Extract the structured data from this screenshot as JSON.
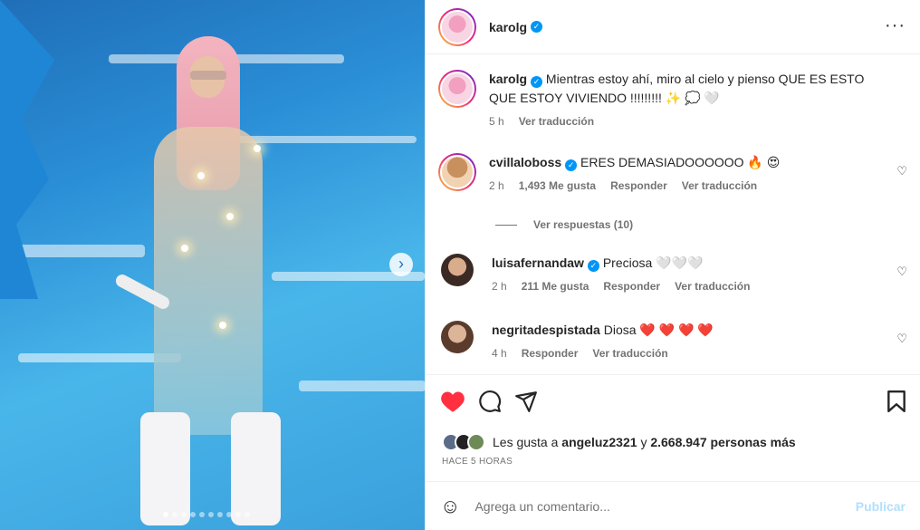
{
  "post": {
    "username": "karolg",
    "verified_glyph": "✓",
    "more_icon": "···",
    "next_arrow": "›",
    "carousel_total": 10,
    "carousel_active": 1
  },
  "caption": {
    "username": "karolg",
    "text": "Mientras estoy ahí, miro al cielo y pienso QUE ES ESTO QUE ESTOY VIVIENDO !!!!!!!!! ✨ 💭 🤍",
    "time": "5 h",
    "translate": "Ver traducción"
  },
  "comments": [
    {
      "username": "cvillaloboss",
      "verified": true,
      "text": "ERES DEMASIADOOOOOO 🔥 😍",
      "time": "2 h",
      "likes": "1,493 Me gusta",
      "reply": "Responder",
      "translate": "Ver traducción",
      "view_replies": "Ver respuestas (10)"
    },
    {
      "username": "luisafernandaw",
      "verified": true,
      "text": "Preciosa 🤍🤍🤍",
      "time": "2 h",
      "likes": "211 Me gusta",
      "reply": "Responder",
      "translate": "Ver traducción"
    },
    {
      "username": "negritadespistada",
      "verified": false,
      "text": "Diosa ❤️ ❤️ ❤️ ❤️",
      "time": "4 h",
      "reply": "Responder",
      "translate": "Ver traducción"
    }
  ],
  "likes": {
    "prefix": "Les gusta a",
    "user": "angeluz2321",
    "joiner": "y",
    "count": "2.668.947 personas más"
  },
  "timestamp": "HACE 5 HORAS",
  "add_comment": {
    "placeholder": "Agrega un comentario...",
    "publish": "Publicar",
    "emoji_icon": "☺"
  },
  "colors": {
    "like_red": "#ff3040",
    "verified_blue": "#0095f6",
    "publish_disabled": "#b2dffc"
  }
}
